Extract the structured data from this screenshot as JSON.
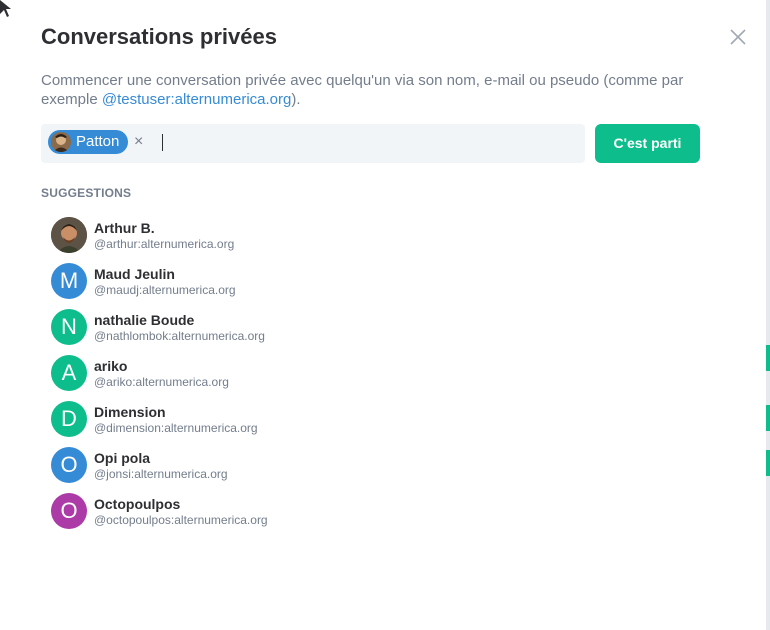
{
  "dialog": {
    "title": "Conversations privées",
    "description_prefix": "Commencer une conversation privée avec quelqu'un via son nom, e-mail ou pseudo (comme par exemple ",
    "description_link": "@testuser:alternumerica.org",
    "description_suffix": ")."
  },
  "picker": {
    "selected_pill_label": "Patton",
    "go_button_label": "C'est parti"
  },
  "suggestions": {
    "label": "SUGGESTIONS",
    "items": [
      {
        "name": "Arthur B.",
        "mxid": "@arthur:alternumerica.org",
        "letter": "",
        "color": "#6b5a4a"
      },
      {
        "name": "Maud Jeulin",
        "mxid": "@maudj:alternumerica.org",
        "letter": "M",
        "color": "#368bd6"
      },
      {
        "name": "nathalie Boude",
        "mxid": "@nathlombok:alternumerica.org",
        "letter": "N",
        "color": "#0dbd8b"
      },
      {
        "name": "ariko",
        "mxid": "@ariko:alternumerica.org",
        "letter": "A",
        "color": "#0dbd8b"
      },
      {
        "name": "Dimension",
        "mxid": "@dimension:alternumerica.org",
        "letter": "D",
        "color": "#0dbd8b"
      },
      {
        "name": "Opi pola",
        "mxid": "@jonsi:alternumerica.org",
        "letter": "O",
        "color": "#368bd6"
      },
      {
        "name": "Octopoulpos",
        "mxid": "@octopoulpos:alternumerica.org",
        "letter": "O",
        "color": "#ac3ba8"
      }
    ]
  },
  "colors": {
    "accent": "#0dbd8b",
    "link": "#368bd6",
    "text": "#2e2f32",
    "muted": "#737d8c"
  }
}
